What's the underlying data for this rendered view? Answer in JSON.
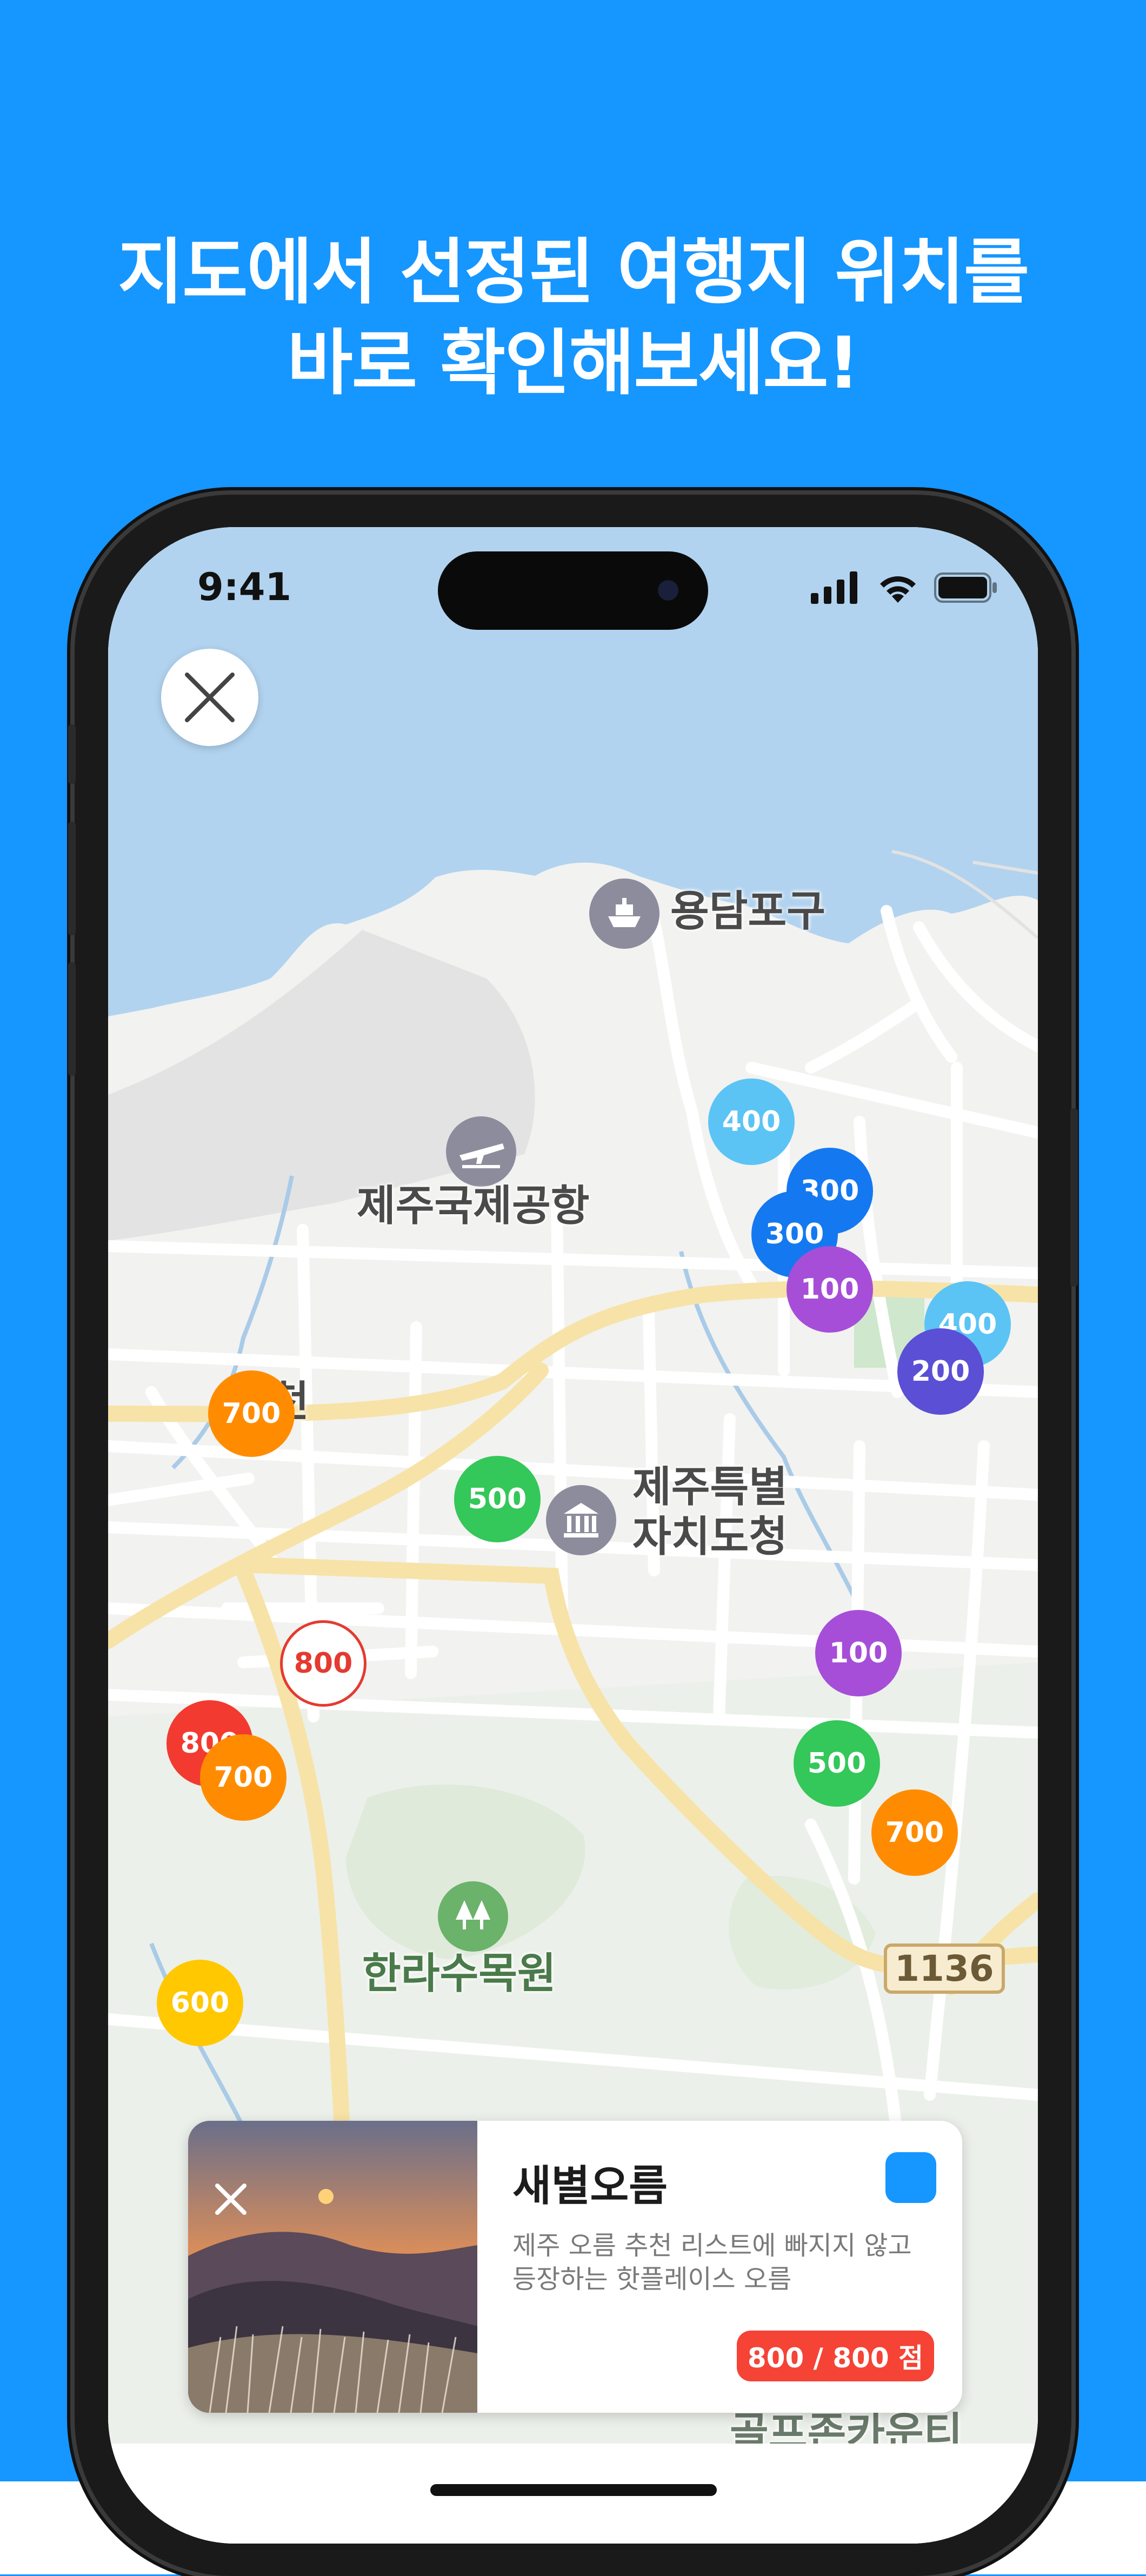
{
  "headline": {
    "line1": "지도에서 선정된 여행지 위치를",
    "line2": "바로 확인해보세요!"
  },
  "status_bar": {
    "time": "9:41",
    "icons": [
      "cellular-signal-icon",
      "wifi-icon",
      "battery-icon"
    ]
  },
  "map": {
    "places": {
      "port": "용담포구",
      "airport": "제주국제공항",
      "gov_line1": "제주특별",
      "gov_line2": "자치도청",
      "arboretum": "한라수목원",
      "bottom_partial": "골프존카운티",
      "left_partial": "천"
    },
    "road_number": "1136",
    "markers": [
      {
        "label": "400",
        "color": "#5bc4f5"
      },
      {
        "label": "300",
        "color": "#1479f0"
      },
      {
        "label": "300",
        "color": "#1479f0"
      },
      {
        "label": "100",
        "color": "#a64ed8"
      },
      {
        "label": "400",
        "color": "#5bc4f5"
      },
      {
        "label": "200",
        "color": "#5b4fd6"
      },
      {
        "label": "700",
        "color": "#ff8c00"
      },
      {
        "label": "500",
        "color": "#34c759"
      },
      {
        "label": "800",
        "color": "#ffffff"
      },
      {
        "label": "100",
        "color": "#a64ed8"
      },
      {
        "label": "500",
        "color": "#34c759"
      },
      {
        "label": "800",
        "color": "#f23a30"
      },
      {
        "label": "700",
        "color": "#ff8c00"
      },
      {
        "label": "700",
        "color": "#ff8c00"
      },
      {
        "label": "600",
        "color": "#ffc800"
      }
    ]
  },
  "card": {
    "title": "새별오름",
    "description": "제주 오름 추천 리스트에 빠지지 않고 등장하는 핫플레이스 오름",
    "score": "800 / 800 점"
  },
  "colors": {
    "background": "#1696ff",
    "accent": "#1696ff",
    "score_badge": "#f54336"
  }
}
